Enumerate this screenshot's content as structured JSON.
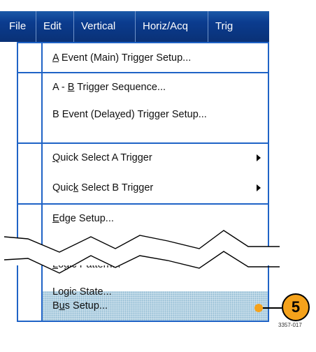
{
  "menubar": {
    "items": [
      {
        "label": "File"
      },
      {
        "label": "Edit"
      },
      {
        "label": "Vertical"
      },
      {
        "label": "Horiz/Acq"
      },
      {
        "label": "Trig"
      }
    ]
  },
  "trigger_menu": {
    "items": [
      {
        "pre": "",
        "u": "A",
        "post": " Event (Main) Trigger Setup..."
      },
      {
        "pre": "A - ",
        "u": "B",
        "post": " Trigger Sequence..."
      },
      {
        "pre": "B Event (Dela",
        "u": "y",
        "post": "ed) Trigger Setup..."
      },
      {
        "pre": "",
        "u": "Q",
        "post": "uick Select A Trigger",
        "submenu": true
      },
      {
        "pre": "Quic",
        "u": "k",
        "post": " Select B Trigger",
        "submenu": true
      },
      {
        "pre": "",
        "u": "E",
        "post": "dge Setup..."
      },
      {
        "pre": "",
        "u": "L",
        "post": "ogic Pattern..."
      },
      {
        "pre": "Logic State...",
        "u": "",
        "post": ""
      },
      {
        "pre": "B",
        "u": "u",
        "post": "s Setup...",
        "highlighted": true
      }
    ]
  },
  "callout": {
    "number": "5",
    "figure_id": "3357-017"
  },
  "colors": {
    "menubar_bg": "#0b3c8f",
    "border": "#1f63c6",
    "callout": "#f5a21b",
    "highlight": "#cfe3ee"
  }
}
